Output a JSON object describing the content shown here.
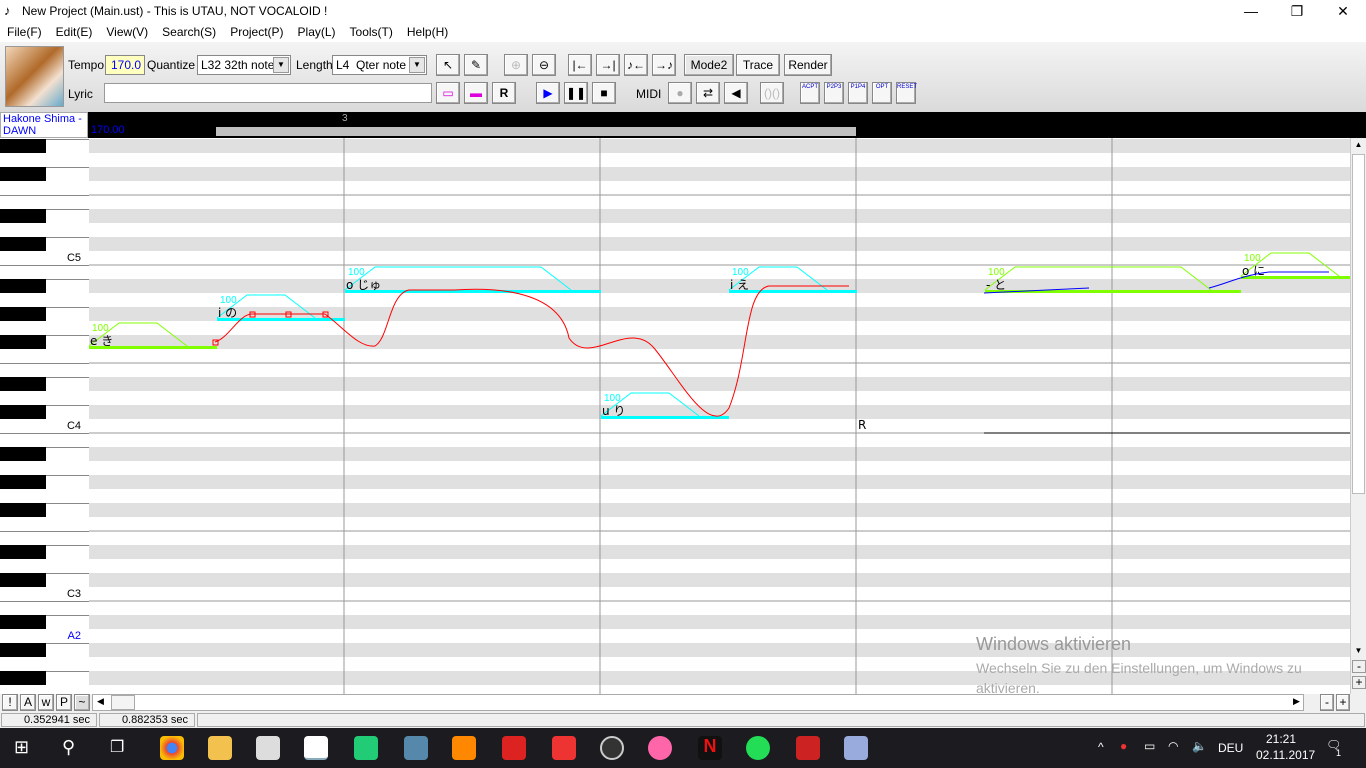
{
  "window": {
    "title": "New Project (Main.ust) - This is UTAU, NOT VOCALOID !",
    "minimize": "—",
    "maximize": "❐",
    "close": "✕"
  },
  "menu": [
    "File(F)",
    "Edit(E)",
    "View(V)",
    "Search(S)",
    "Project(P)",
    "Play(L)",
    "Tools(T)",
    "Help(H)"
  ],
  "toolbar": {
    "tempo_label": "Tempo",
    "tempo": "170.0",
    "quantize_label": "Quantize",
    "quantize": "L32 32th note",
    "length_label": "Length",
    "length": "L4  Qter note",
    "lyric_label": "Lyric",
    "lyric": "",
    "midi_label": "MIDI",
    "mode2": "Mode2",
    "trace": "Trace",
    "render": "Render",
    "acpt": "ACPT",
    "p2p3": "P2P3",
    "p1p4": "P1P4",
    "opt": "OPT",
    "reset": "RESET"
  },
  "header": {
    "singer": "Hakone Shima - DAWN",
    "measure": "3",
    "tempo": "170.00"
  },
  "piano": {
    "labels": [
      {
        "name": "C5",
        "midi": 72
      },
      {
        "name": "C4",
        "midi": 60
      },
      {
        "name": "C3",
        "midi": 48
      },
      {
        "name": "A2",
        "midi": 45
      }
    ]
  },
  "notes": [
    {
      "lyric": "e き",
      "midi": 66,
      "start": 0,
      "len": 2,
      "velocity": "100",
      "color": "#80ff00"
    },
    {
      "lyric": "i の",
      "midi": 68,
      "start": 2,
      "len": 2,
      "velocity": "100",
      "color": "#00ffff"
    },
    {
      "lyric": "o じゅ",
      "midi": 70,
      "start": 4,
      "len": 4,
      "velocity": "100",
      "color": "#00ffff"
    },
    {
      "lyric": "u り",
      "midi": 61,
      "start": 8,
      "len": 2,
      "velocity": "100",
      "color": "#00ffff"
    },
    {
      "lyric": "i え",
      "midi": 70,
      "start": 10,
      "len": 2,
      "velocity": "100",
      "color": "#00ffff"
    },
    {
      "lyric": "R",
      "midi": 60,
      "start": 12,
      "len": 2,
      "velocity": "",
      "color": "#000000"
    },
    {
      "lyric": "- と",
      "midi": 70,
      "start": 14,
      "len": 4,
      "velocity": "100",
      "color": "#80ff00"
    },
    {
      "lyric": "o に",
      "midi": 71,
      "start": 18,
      "len": 2,
      "velocity": "100",
      "color": "#80ff00"
    }
  ],
  "bottom_buttons": [
    "!",
    "A",
    "w",
    "P",
    "~"
  ],
  "status": {
    "time1": "0.352941 sec",
    "time2": "0.882353 sec"
  },
  "watermark": {
    "title": "Windows aktivieren",
    "text": "Wechseln Sie zu den Einstellungen, um Windows zu aktivieren."
  },
  "taskbar": {
    "lang": "DEU",
    "time": "21:21",
    "date": "02.11.2017",
    "notif": "1"
  }
}
